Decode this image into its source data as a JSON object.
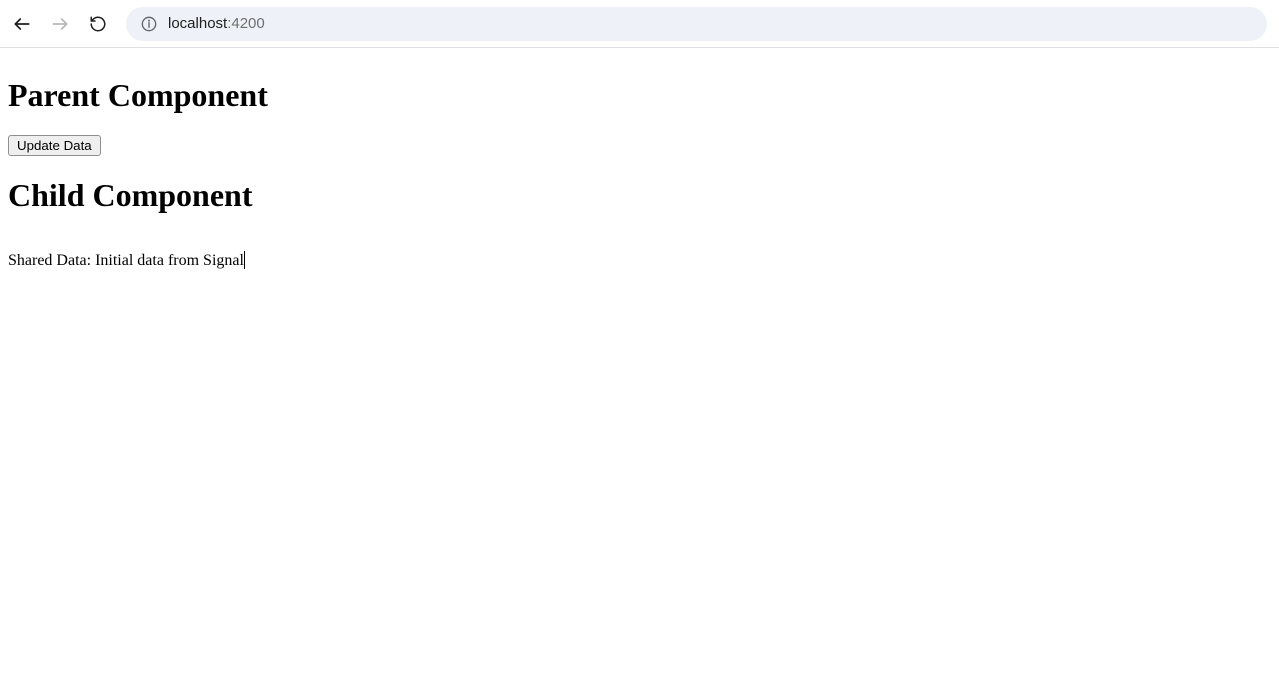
{
  "browser": {
    "url_host": "localhost",
    "url_port": ":4200"
  },
  "page": {
    "parent_heading": "Parent Component",
    "update_button_label": "Update Data",
    "child_heading": "Child Component",
    "shared_data_text": "Shared Data: Initial data from Signal"
  }
}
